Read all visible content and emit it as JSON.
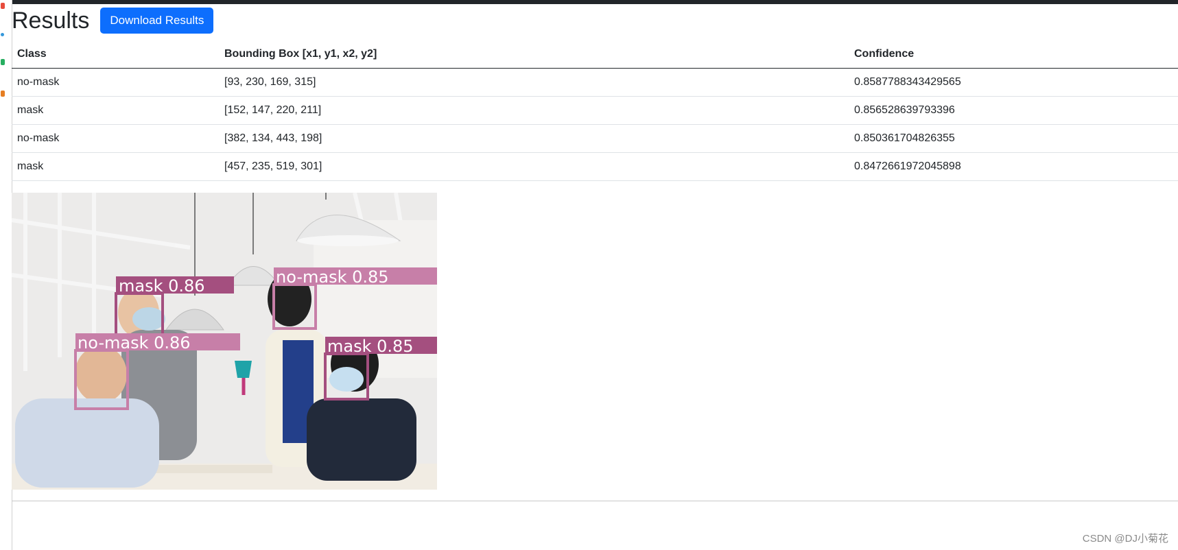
{
  "header": {
    "title": "Results",
    "download_label": "Download Results"
  },
  "table": {
    "columns": [
      "Class",
      "Bounding Box [x1, y1, x2, y2]",
      "Confidence"
    ],
    "rows": [
      {
        "class": "no-mask",
        "bbox": "[93, 230, 169, 315]",
        "confidence": "0.8587788343429565"
      },
      {
        "class": "mask",
        "bbox": "[152, 147, 220, 211]",
        "confidence": "0.856528639793396"
      },
      {
        "class": "no-mask",
        "bbox": "[382, 134, 443, 198]",
        "confidence": "0.850361704826355"
      },
      {
        "class": "mask",
        "bbox": "[457, 235, 519, 301]",
        "confidence": "0.8472661972045898"
      }
    ]
  },
  "image": {
    "detection_labels": [
      "mask 0.86",
      "no-mask 0.85",
      "no-mask 0.86",
      "mask 0.85"
    ],
    "box_colors": {
      "mask": "#a44f7f",
      "no-mask": "#c77fa8"
    }
  },
  "watermark": "CSDN @DJ小菊花",
  "colors": {
    "primary": "#0d6efd",
    "topbar": "#212529"
  }
}
